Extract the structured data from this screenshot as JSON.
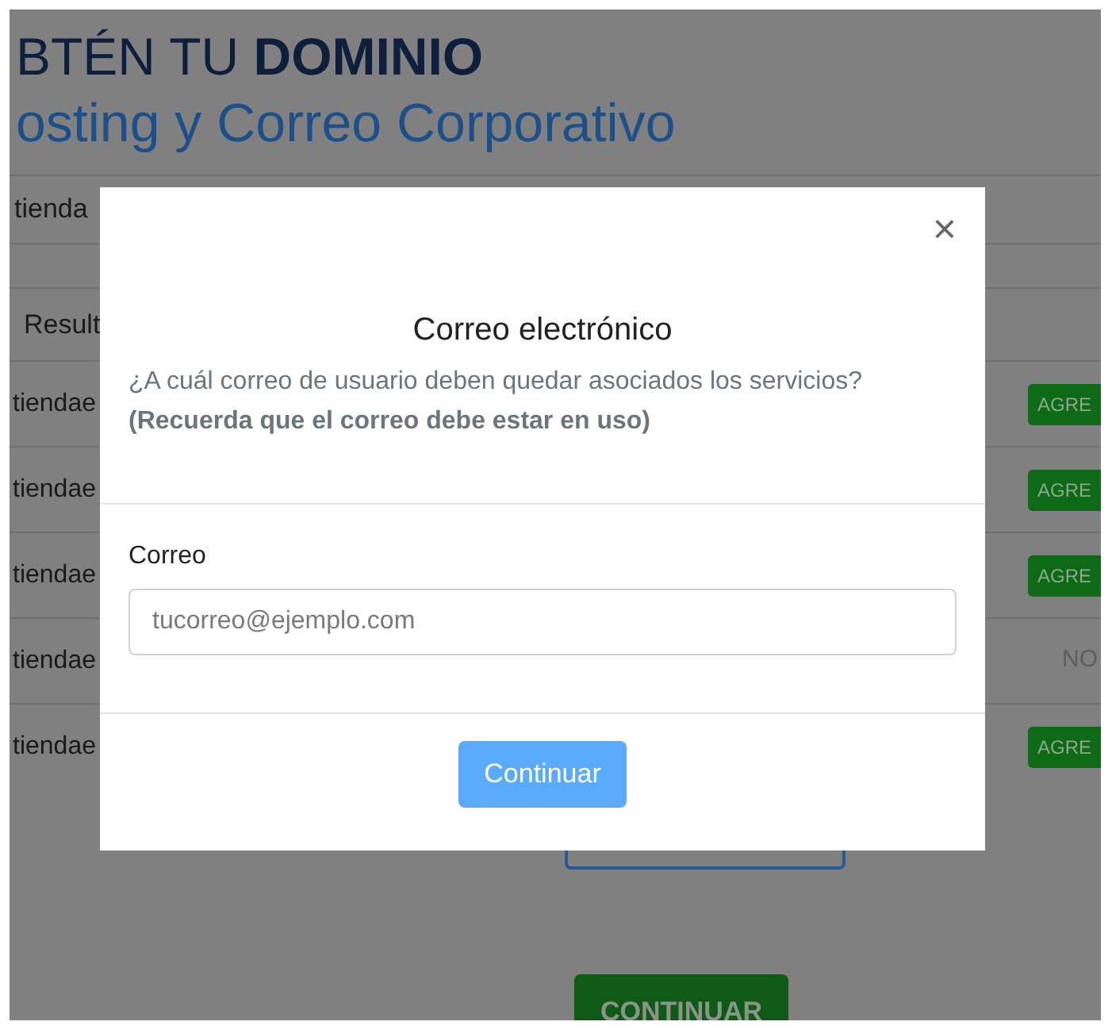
{
  "page": {
    "title": "BTÉN TU **DOMINIO**",
    "subtitle": "osting y Correo Corporativo",
    "search_value": "tienda",
    "results_heading": "Result",
    "rows": [
      {
        "domain": "tiendae",
        "status": "AGRE",
        "kind": "badge"
      },
      {
        "domain": "tiendae",
        "status": "AGRE",
        "kind": "badge"
      },
      {
        "domain": "tiendae",
        "status": "AGRE",
        "kind": "badge"
      },
      {
        "domain": "tiendae",
        "status": "NO",
        "kind": "text"
      },
      {
        "domain": "tiendae",
        "status": "AGRE",
        "kind": "badge"
      }
    ],
    "continue_button": "CONTINUAR"
  },
  "modal": {
    "close": "×",
    "title": "Correo electrónico",
    "question": "¿A cuál correo de usuario deben quedar asociados los servicios?",
    "note": "(Recuerda que el correo debe estar en uso)",
    "field_label": "Correo",
    "placeholder": "tucorreo@ejemplo.com",
    "button": "Continuar"
  }
}
